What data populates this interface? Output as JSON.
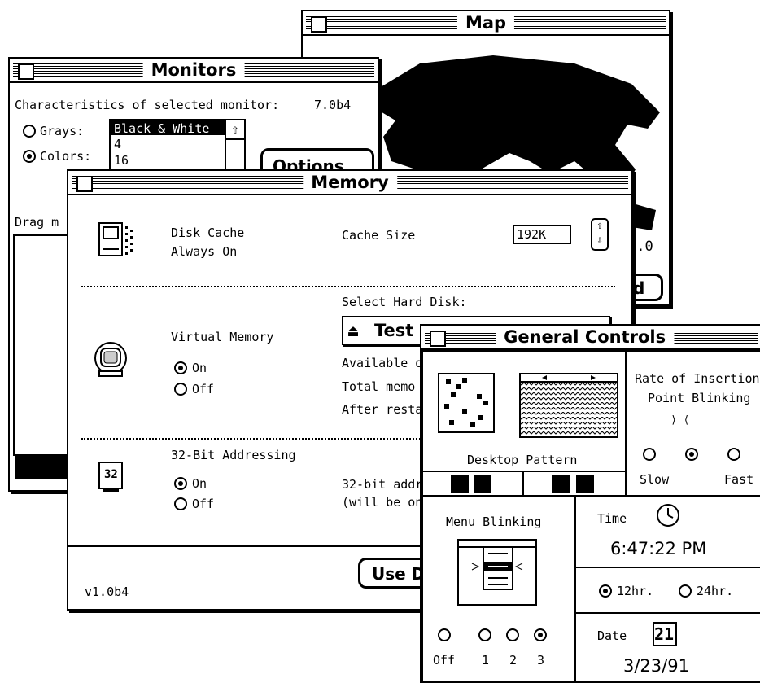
{
  "map": {
    "title": "Map",
    "version": "7.0",
    "button": "d"
  },
  "monitors": {
    "title": "Monitors",
    "heading": "Characteristics of selected monitor:",
    "version": "7.0b4",
    "grays_label": "Grays:",
    "colors_label": "Colors:",
    "depth_options": [
      "Black & White",
      "4",
      "16"
    ],
    "options_button": "Options",
    "drag_label": "Drag m"
  },
  "memory": {
    "title": "Memory",
    "disk_cache_label": "Disk Cache",
    "disk_cache_state": "Always On",
    "cache_size_label": "Cache Size",
    "cache_size_value": "192K",
    "select_disk_label": "Select Hard Disk:",
    "disk_name": "Test",
    "virtual_memory_label": "Virtual Memory",
    "vm_on": "On",
    "vm_off": "Off",
    "available_label": "Available o",
    "total_label": "Total memo",
    "after_label": "After resta",
    "addr_label": "32-Bit Addressing",
    "addr_on": "On",
    "addr_off": "Off",
    "addr_icon_text": "32",
    "addr_note_1": "32-bit addr",
    "addr_note_2": "(will be on",
    "use_button": "Use D",
    "version": "v1.0b4"
  },
  "general": {
    "title": "General Controls",
    "desktop_pattern_label": "Desktop Pattern",
    "rate_label_1": "Rate of Insertion",
    "rate_label_2": "Point Blinking",
    "rate_slow": "Slow",
    "rate_fast": "Fast",
    "menu_blinking_label": "Menu Blinking",
    "blink_options": [
      "Off",
      "1",
      "2",
      "3"
    ],
    "time_label": "Time",
    "time_value": "6:47:22 PM",
    "hr12": "12hr.",
    "hr24": "24hr.",
    "date_label": "Date",
    "date_icon_text": "21",
    "date_value": "3/23/91"
  }
}
